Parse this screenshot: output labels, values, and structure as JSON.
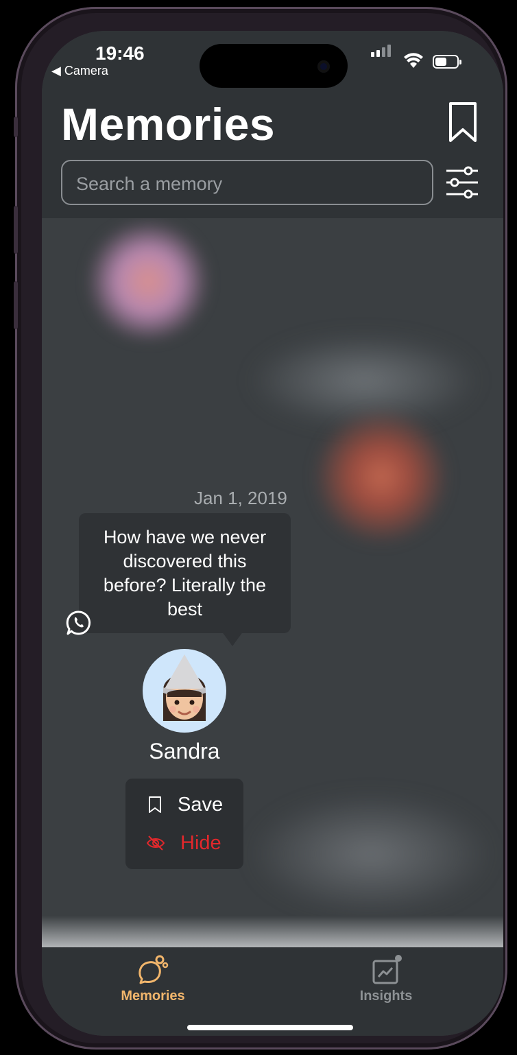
{
  "status_bar": {
    "time": "19:46",
    "back_label": "◀ Camera"
  },
  "header": {
    "title": "Memories",
    "search_placeholder": "Search a memory"
  },
  "memory": {
    "date": "Jan 1, 2019",
    "message": "How have we never discovered this before? Literally the best",
    "source_icon": "whatsapp-icon",
    "person_name": "Sandra"
  },
  "context_menu": {
    "save_label": "Save",
    "hide_label": "Hide"
  },
  "tabbar": {
    "tabs": [
      {
        "label": "Memories",
        "icon": "memories-icon",
        "active": true
      },
      {
        "label": "Insights",
        "icon": "insights-icon",
        "active": false
      }
    ]
  },
  "colors": {
    "accent": "#f2b66c",
    "danger": "#e2282c",
    "background": "#3b3f42",
    "header": "#2f3336",
    "inactive_tab": "#8d9194"
  }
}
